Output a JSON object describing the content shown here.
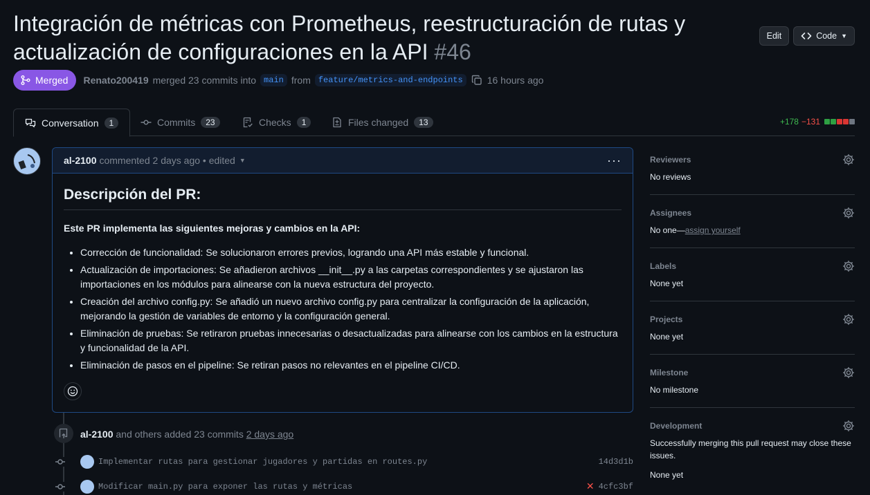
{
  "pr": {
    "title": "Integración de métricas con Prometheus, reestructuración de rutas y actualización de configuraciones en la API",
    "number": "#46",
    "status": "Merged",
    "author": "Renato200419",
    "merge_text": "merged 23 commits into",
    "base_branch": "main",
    "from_text": "from",
    "head_branch": "feature/metrics-and-endpoints",
    "time": "16 hours ago"
  },
  "header_actions": {
    "edit": "Edit",
    "code": "Code"
  },
  "tabs": [
    {
      "label": "Conversation",
      "count": "1"
    },
    {
      "label": "Commits",
      "count": "23"
    },
    {
      "label": "Checks",
      "count": "1"
    },
    {
      "label": "Files changed",
      "count": "13"
    }
  ],
  "diffstat": {
    "additions": "+178",
    "deletions": "−131",
    "colors": [
      "#2ea043",
      "#2ea043",
      "#da3633",
      "#da3633",
      "#6e7681"
    ]
  },
  "comment": {
    "author": "al-2100",
    "meta": "commented 2 days ago • edited",
    "heading": "Descripción del PR:",
    "intro": "Este PR implementa las siguientes mejoras y cambios en la API:",
    "items": [
      "Corrección de funcionalidad: Se solucionaron errores previos, logrando una API más estable y funcional.",
      "Actualización de importaciones: Se añadieron archivos __init__.py a las carpetas correspondientes y se ajustaron las importaciones en los módulos para alinearse con la nueva estructura del proyecto.",
      "Creación del archivo config.py: Se añadió un nuevo archivo config.py para centralizar la configuración de la aplicación, mejorando la gestión de variables de entorno y la configuración general.",
      "Eliminación de pruebas: Se retiraron pruebas innecesarias o desactualizadas para alinearse con los cambios en la estructura y funcionalidad de la API.",
      "Eliminación de pasos en el pipeline: Se retiran pasos no relevantes en el pipeline CI/CD."
    ]
  },
  "timeline": {
    "author": "al-2100",
    "text": "and others added 23 commits",
    "when": "2 days ago",
    "commits": [
      {
        "message": "Implementar rutas para gestionar jugadores y partidas en routes.py",
        "sha": "14d3d1b",
        "failed": false
      },
      {
        "message": "Modificar main.py para exponer las rutas y métricas",
        "sha": "4cfc3bf",
        "failed": true
      }
    ]
  },
  "sidebar": {
    "reviewers": {
      "title": "Reviewers",
      "value": "No reviews"
    },
    "assignees": {
      "title": "Assignees",
      "value": "No one—",
      "link": "assign yourself"
    },
    "labels": {
      "title": "Labels",
      "value": "None yet"
    },
    "projects": {
      "title": "Projects",
      "value": "None yet"
    },
    "milestone": {
      "title": "Milestone",
      "value": "No milestone"
    },
    "development": {
      "title": "Development",
      "note": "Successfully merging this pull request may close these issues.",
      "value": "None yet"
    }
  }
}
